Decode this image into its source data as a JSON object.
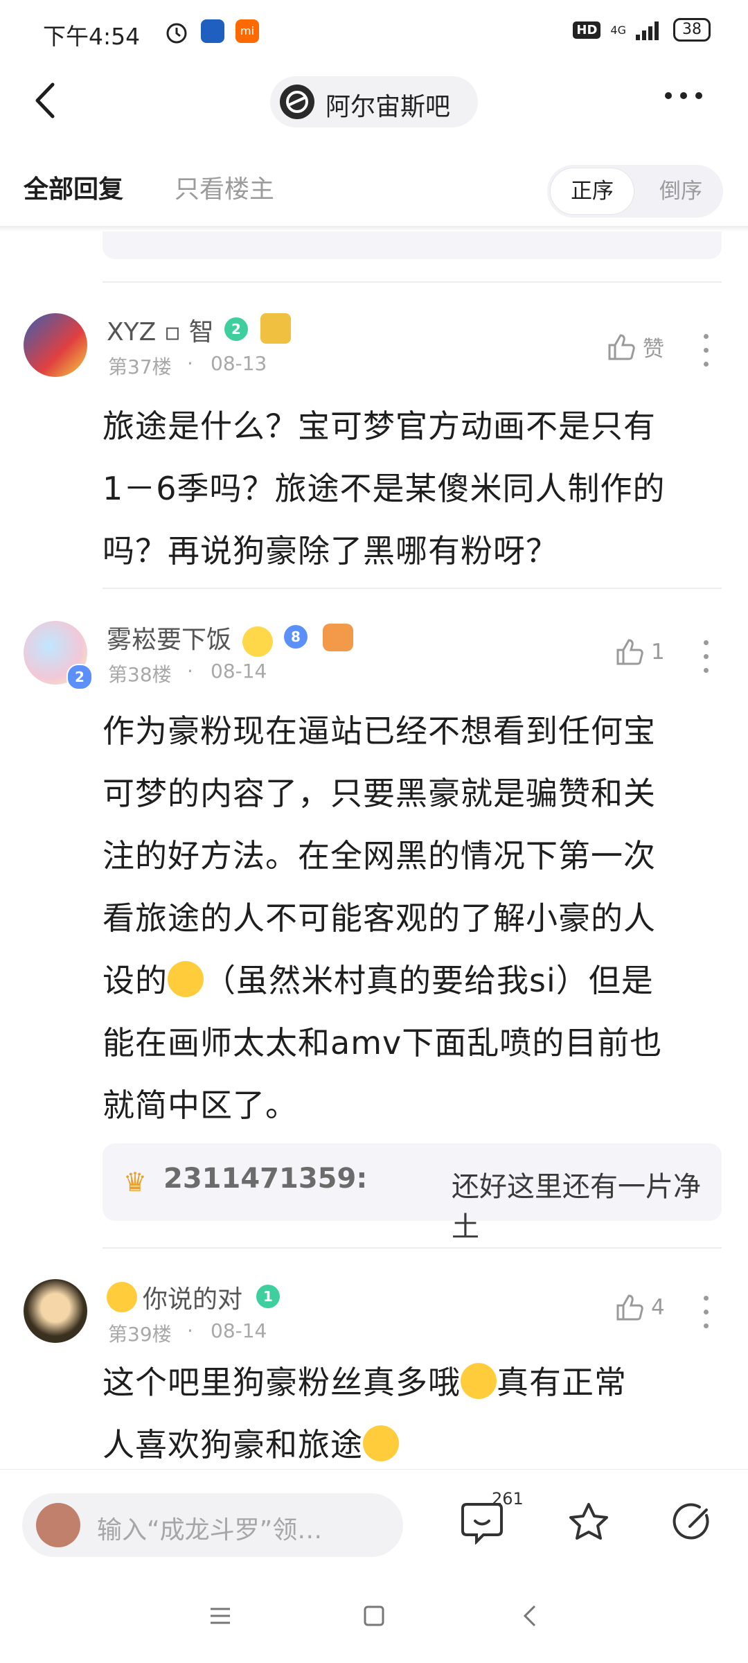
{
  "status_bar": {
    "time": "下午4:54",
    "network": "HD",
    "signal": "4G",
    "battery": "38"
  },
  "header": {
    "forum_name": "阿尔宙斯吧"
  },
  "tabs": {
    "all": "全部回复",
    "owner_only": "只看楼主",
    "order_asc": "正序",
    "order_desc": "倒序"
  },
  "posts": [
    {
      "username": "XYZ ▫ 智",
      "level": "2",
      "floor": "第37楼",
      "date": "08-13",
      "likes": "赞",
      "text": [
        "旅途是什么？宝可梦官方动画不是只有",
        "1－6季吗？旅途不是某傻米同人制作的",
        "吗？再说狗豪除了黑哪有粉呀？"
      ]
    },
    {
      "username": "雾崧要下饭",
      "level": "8",
      "avatar_level": "2",
      "floor": "第38楼",
      "date": "08-14",
      "likes": "1",
      "text": [
        "作为豪粉现在逼站已经不想看到任何宝",
        "可梦的内容了，只要黑豪就是骗赞和关",
        "注的好方法。在全网黑的情况下第一次",
        "看旅途的人不可能客观的了解小豪的人",
        "设的",
        "（虽然米村真的要给我si）但是",
        "能在画师太太和amv下面乱喷的目前也",
        "就简中区了。"
      ],
      "reply": {
        "user": "2311471359:",
        "text": "还好这里还有一片净土"
      }
    },
    {
      "username": "你说的对",
      "level": "1",
      "floor": "第39楼",
      "date": "08-14",
      "likes": "4",
      "text": [
        "这个吧里狗豪粉丝真多哦",
        "真有正常",
        "人喜欢狗豪和旅途"
      ]
    }
  ],
  "bottom_bar": {
    "input_placeholder": "输入“成龙斗罗”领…",
    "comment_count": "261"
  },
  "colors": {
    "level_green": "#3fcf9f",
    "level_blue": "#5b8ff9",
    "accent_text": "#1e1e1e",
    "muted": "#a8a8a8"
  }
}
